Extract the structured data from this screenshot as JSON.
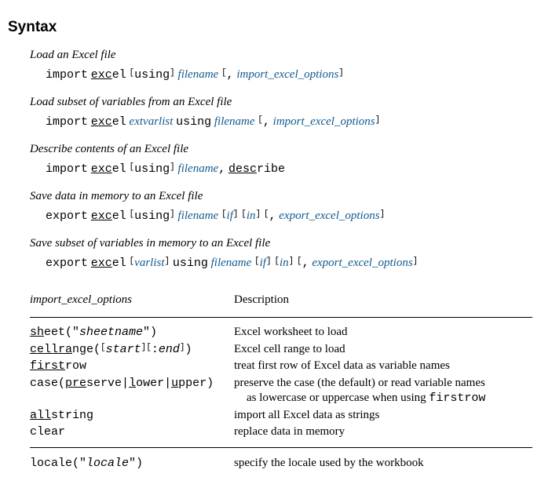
{
  "heading": "Syntax",
  "blocks": [
    {
      "title": "Load an Excel file"
    },
    {
      "title": "Load subset of variables from an Excel file"
    },
    {
      "title": "Describe contents of an Excel file"
    },
    {
      "title": "Save data in memory to an Excel file"
    },
    {
      "title": "Save subset of variables in memory to an Excel file"
    }
  ],
  "tok": {
    "import": "import",
    "export": "export",
    "exc_ul": "exc",
    "el": "el",
    "using": "using",
    "filename": "filename",
    "comma": ",",
    "import_opts": "import_excel_options",
    "export_opts": "export_excel_options",
    "extvarlist": "extvarlist",
    "desc_ul": "desc",
    "ribe": "ribe",
    "if": "if",
    "in": "in",
    "varlist": "varlist",
    "lbr": "[",
    "rbr": "]"
  },
  "table": {
    "h1": "import_excel_options",
    "h2": "Description",
    "rows": {
      "sheet": {
        "o1": "sh",
        "o2": "eet(\"",
        "o3": "sheetname",
        "o4": "\")",
        "desc": "Excel worksheet to load"
      },
      "cellrange": {
        "o1": "cellra",
        "o2": "nge(",
        "o3": "start",
        "o4": ":",
        "o5": "end",
        "o6": ")",
        "desc": "Excel cell range to load"
      },
      "firstrow": {
        "o1": "first",
        "o2": "row",
        "desc": "treat first row of Excel data as variable names"
      },
      "case": {
        "o1": "case(",
        "o2": "pre",
        "o3": "serve",
        "o4": "|",
        "o5": "l",
        "o6": "ower",
        "o7": "|",
        "o8": "u",
        "o9": "pper)",
        "desc1": "preserve the case (the default) or read variable names",
        "desc2": "as lowercase or uppercase when using ",
        "desc3": "firstrow"
      },
      "allstring": {
        "o1": "all",
        "o2": "string",
        "desc": "import all Excel data as strings"
      },
      "clear": {
        "o1": "clear",
        "desc": "replace data in memory"
      },
      "locale": {
        "o1": "locale(\"",
        "o2": "locale",
        "o3": "\")",
        "desc": "specify the locale used by the workbook"
      }
    }
  }
}
